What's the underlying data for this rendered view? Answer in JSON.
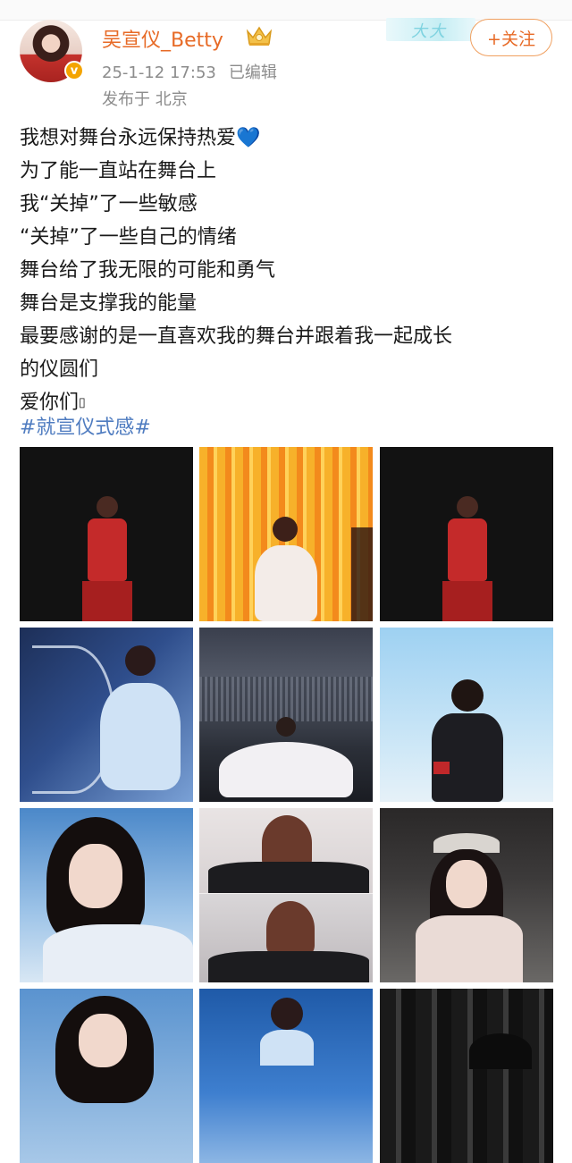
{
  "header": {
    "username": "吴宣仪_Betty",
    "timestamp": "25-1-12 17:53",
    "edited_label": "已编辑",
    "location": "发布于 北京",
    "follow_label": "+关注",
    "banner_text": "大大"
  },
  "post": {
    "lines": [
      "我想对舞台永远保持热爱",
      "为了能一直站在舞台上",
      "我“关掉”了一些敏感",
      "“关掉”了一些自己的情绪",
      "舞台给了我无限的可能和勇气",
      "舞台是支撑我的能量",
      "最要感谢的是一直喜欢我的舞台并跟着我一起成长",
      "的仪圆们",
      "爱你们"
    ],
    "heart_emoji": "💙",
    "tail_glyph": "▯",
    "hashtag": "#就宣仪式感#"
  },
  "photos": [
    {
      "name": "stage-red-outfit-1"
    },
    {
      "name": "stage-orange-lights"
    },
    {
      "name": "stage-red-outfit-2"
    },
    {
      "name": "crystal-bow-photoshoot"
    },
    {
      "name": "arena-white-gown"
    },
    {
      "name": "black-leather-jacket"
    },
    {
      "name": "dark-hair-portrait"
    },
    {
      "name": "heart-gesture-collage"
    },
    {
      "name": "crown-lace-dress"
    },
    {
      "name": "blue-sky-portrait"
    },
    {
      "name": "stage-blue-backdrop"
    },
    {
      "name": "studded-stage-closeup"
    }
  ],
  "colors": {
    "username": "#e76a26",
    "hashtag": "#4f7cc0",
    "meta": "#8c8c8c",
    "verified_badge": "#f4a400"
  }
}
